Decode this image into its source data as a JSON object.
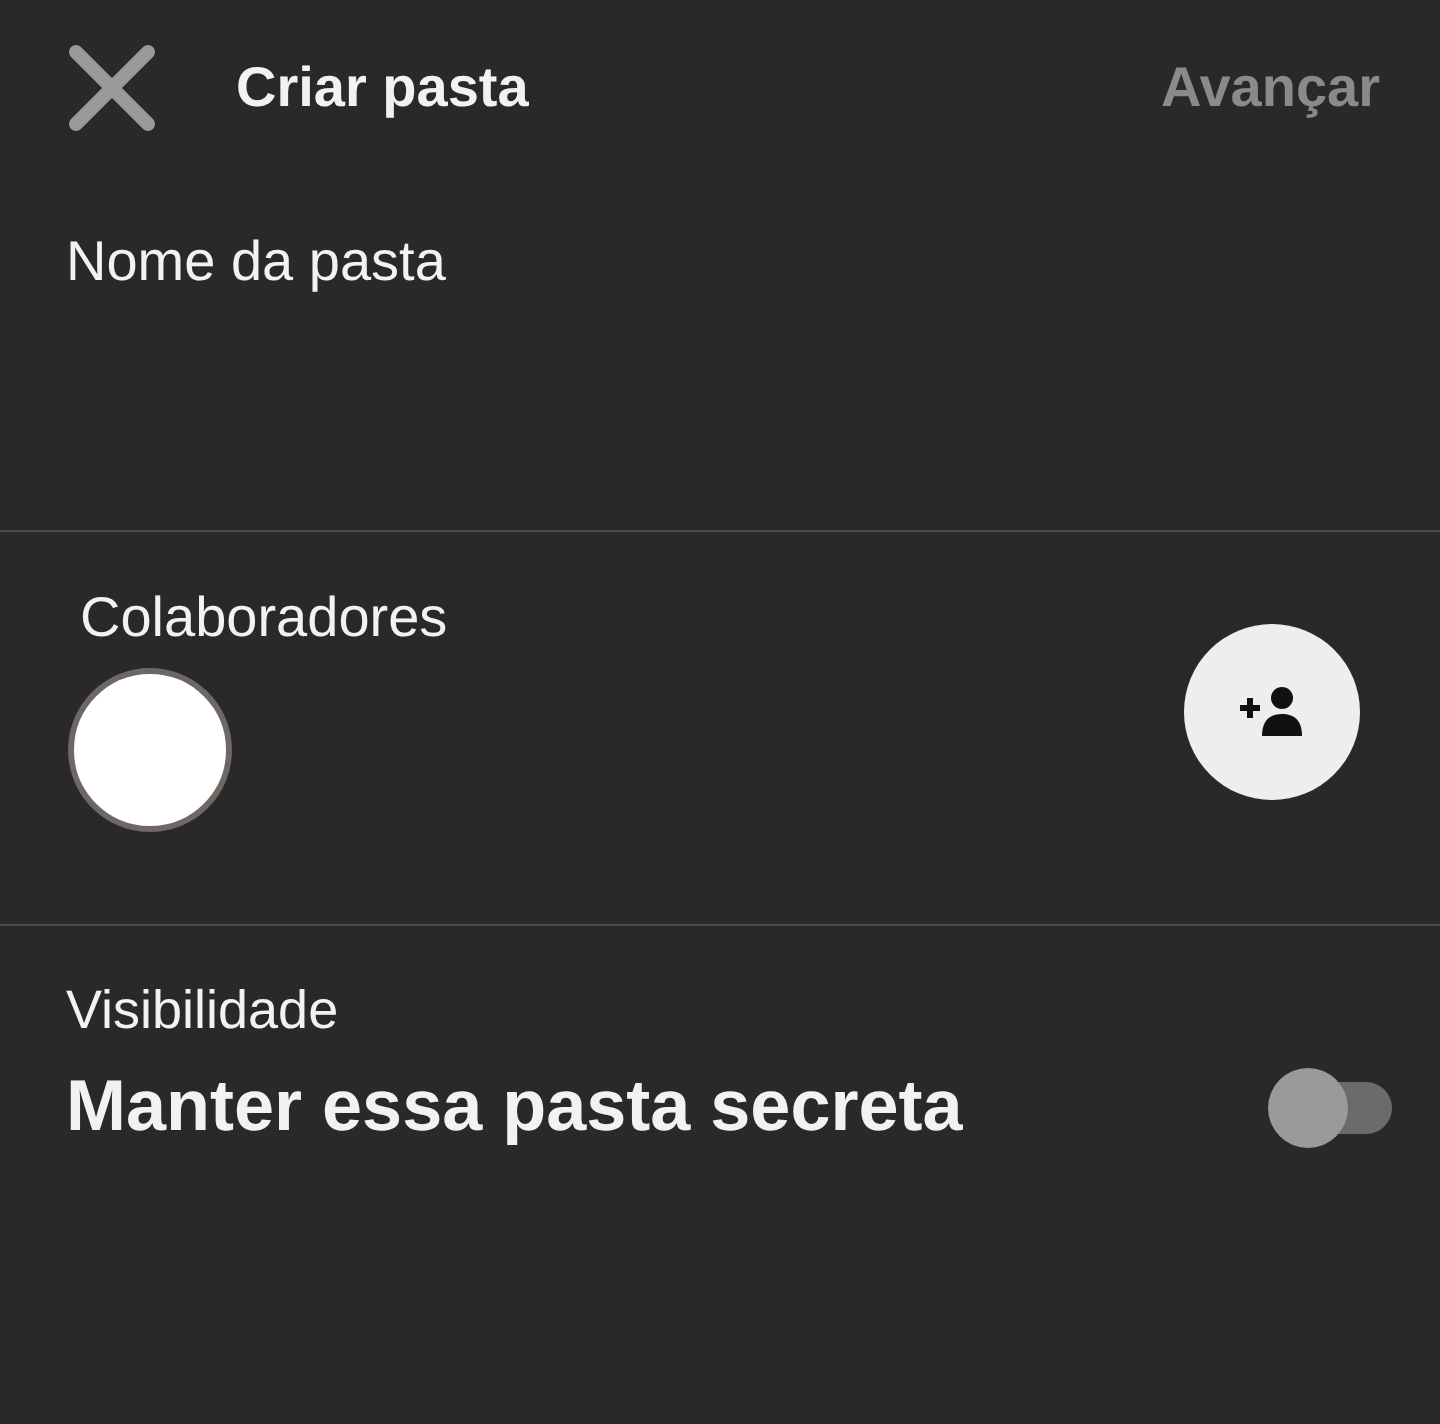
{
  "header": {
    "title": "Criar pasta",
    "action": "Avançar",
    "action_disabled": true
  },
  "name_field": {
    "placeholder": "Nome da pasta"
  },
  "collaborators": {
    "label": "Colaboradores"
  },
  "visibility": {
    "label": "Visibilidade",
    "option": "Manter essa pasta secreta",
    "on": false
  }
}
